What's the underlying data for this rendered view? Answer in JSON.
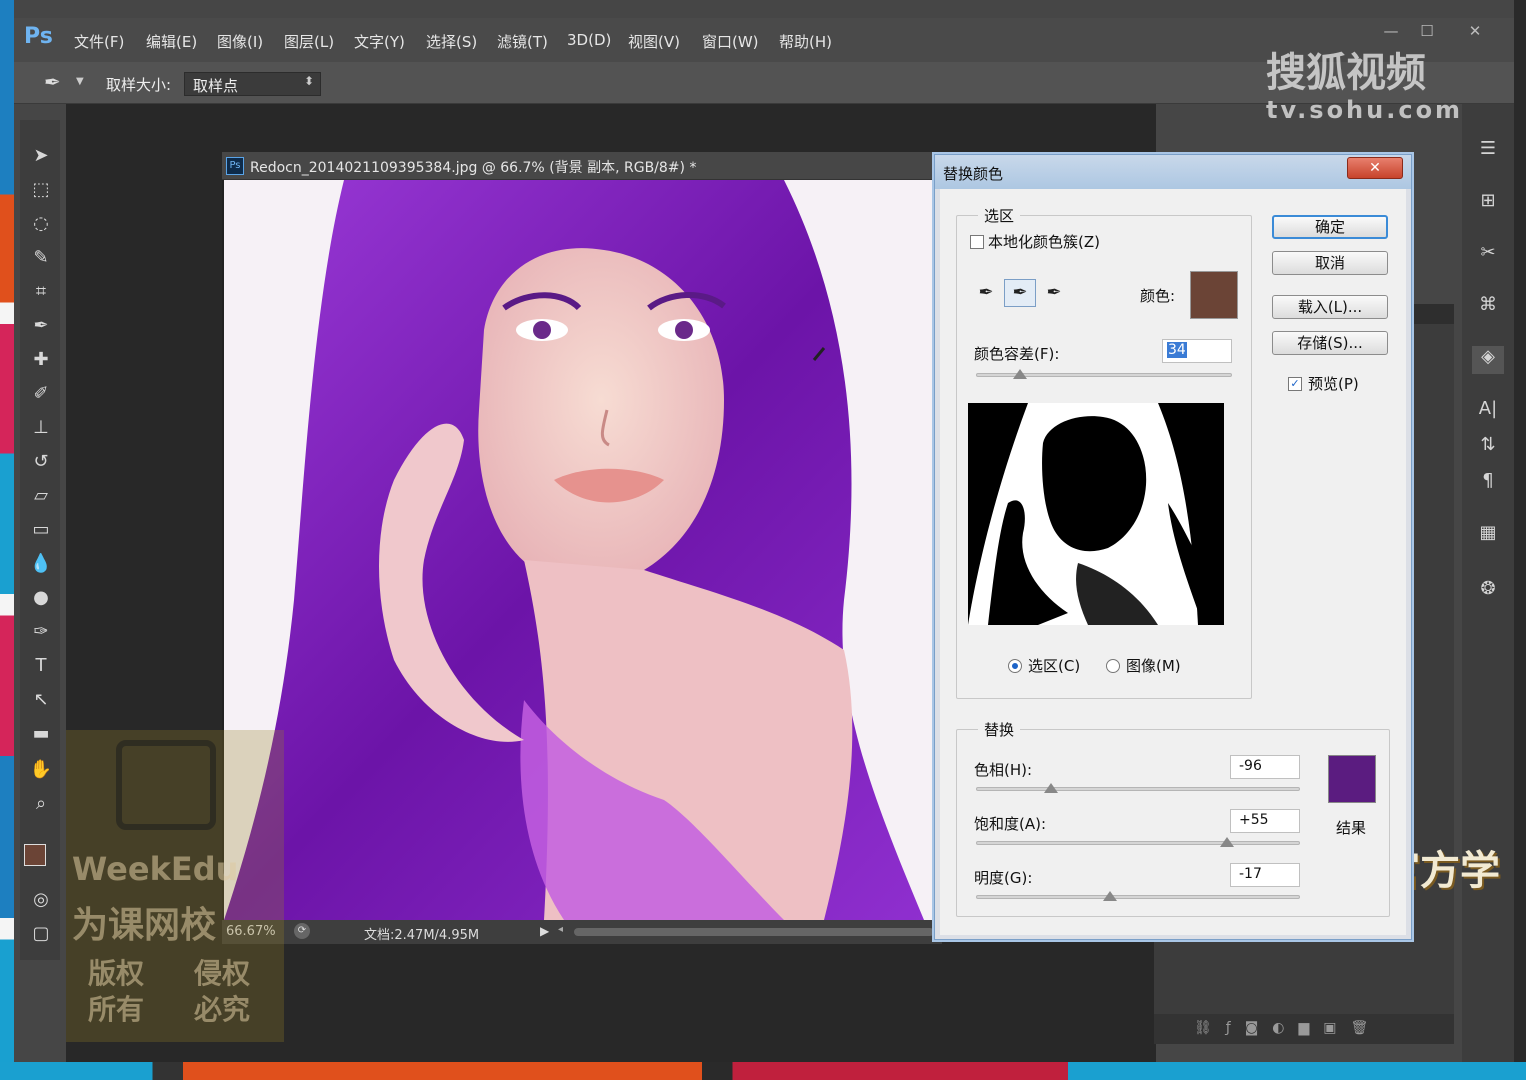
{
  "app": {
    "logo": "Ps",
    "menu": [
      "文件(F)",
      "编辑(E)",
      "图像(I)",
      "图层(L)",
      "文字(Y)",
      "选择(S)",
      "滤镜(T)",
      "3D(D)",
      "视图(V)",
      "窗口(W)",
      "帮助(H)"
    ],
    "window_controls": [
      "—",
      "☐",
      "✕"
    ]
  },
  "options": {
    "sample_size_label": "取样大小:",
    "sample_size_value": "取样点"
  },
  "document": {
    "title": "Redocn_2014021109395384.jpg @ 66.7% (背景 副本, RGB/8#) *",
    "zoom": "66.67%",
    "doc_info": "文档:2.47M/4.95M"
  },
  "dialog": {
    "title": "替换颜色",
    "selection_group": "选区",
    "localized_clusters_label": "本地化颜色簇(Z)",
    "localized_clusters_checked": false,
    "color_label": "颜色:",
    "color_swatch": "#6b4436",
    "fuzziness_label": "颜色容差(F):",
    "fuzziness_value": "34",
    "fuzziness_fraction": 0.17,
    "radio_selection": "选区(C)",
    "radio_image": "图像(M)",
    "radio_selected": "selection",
    "replace_group": "替换",
    "hue_label": "色相(H):",
    "hue_value": "-96",
    "hue_fraction": 0.233,
    "saturation_label": "饱和度(A):",
    "saturation_value": "+55",
    "saturation_fraction": 0.775,
    "lightness_label": "明度(G):",
    "lightness_value": "-17",
    "lightness_fraction": 0.415,
    "result_label": "结果",
    "result_swatch": "#5b1c80",
    "ok": "确定",
    "cancel": "取消",
    "load": "载入(L)...",
    "save": "存储(S)...",
    "preview_label": "预览(P)",
    "preview_checked": true,
    "close": "✕"
  },
  "watermarks": {
    "sohu_top": "搜狐视频",
    "sohu_url": "tv.sohu.com",
    "weekedu": "WeekEdu",
    "weekedu_cn": "为课网校",
    "rights1": "版权",
    "rights2": "所有",
    "rights3": "侵权",
    "rights4": "必究",
    "join": "加官方学"
  },
  "colors": {
    "accent": "#3b8bd7",
    "purple_hair": "#7b1fb6",
    "foreground": "#6b4436",
    "background": "#ffffff"
  }
}
